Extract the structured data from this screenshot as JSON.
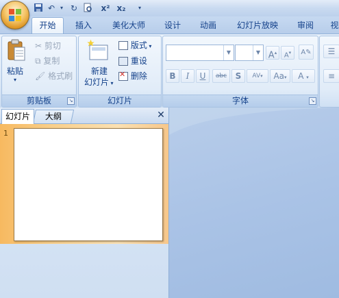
{
  "ribbon_tabs": {
    "home": "开始",
    "insert": "插入",
    "design_beautify": "美化大师",
    "design": "设计",
    "animation": "动画",
    "slideshow": "幻灯片放映",
    "review": "审阅",
    "view": "视"
  },
  "clipboard": {
    "paste": "粘贴",
    "cut": "剪切",
    "copy": "复制",
    "format_painter": "格式刷",
    "group_label": "剪贴板"
  },
  "slides": {
    "new_slide_line1": "新建",
    "new_slide_line2": "幻灯片",
    "layout": "版式",
    "reset": "重设",
    "delete": "删除",
    "group_label": "幻灯片"
  },
  "font": {
    "group_label": "字体",
    "font_name_value": "",
    "font_size_value": "",
    "bold": "B",
    "italic": "I",
    "underline": "U",
    "strike": "abc",
    "shadow": "S",
    "spacing": "AV",
    "change_case": "Aa",
    "font_color": "A",
    "grow": "A",
    "shrink": "A"
  },
  "pane": {
    "slides_tab": "幻灯片",
    "outline_tab": "大纲",
    "close": "✕",
    "slide_number": "1"
  },
  "colors": {
    "accent": "#15428b",
    "selected_slide_bg": "#f9cf8a",
    "workspace": "#aac3e6"
  }
}
